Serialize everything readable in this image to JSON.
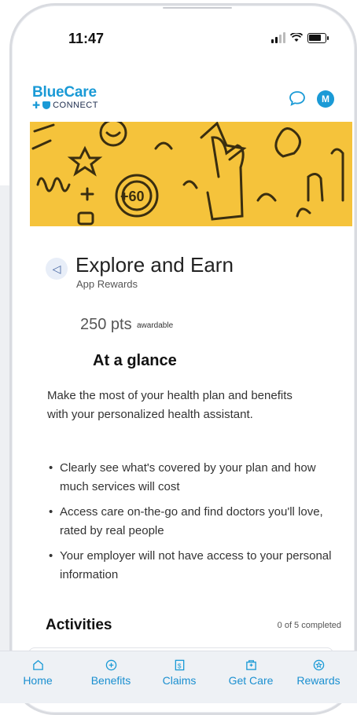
{
  "status_bar": {
    "time": "11:47"
  },
  "header": {
    "brand": "BlueCare",
    "brand_sub": "CONNECT",
    "avatar_initial": "M"
  },
  "colors": {
    "accent": "#1a9ad6",
    "hero_bg": "#f5c33b",
    "tab_bg": "#eef1f5"
  },
  "main": {
    "title": "Explore and Earn",
    "subtitle": "App Rewards",
    "points": "250 pts",
    "points_tag": "awardable",
    "section_title": "At a glance",
    "description": "Make the most of your health plan and benefits with your personalized health assistant.",
    "bullets": [
      "Clearly see what's covered by your plan and how much services will cost",
      "Access care on-the-go and find doctors you'll love, rated by real people",
      "Your employer will not have access to your personal information"
    ],
    "activities_title": "Activities",
    "activities_status": "0 of 5 completed"
  },
  "tabs": [
    {
      "label": "Home",
      "icon": "home-icon"
    },
    {
      "label": "Benefits",
      "icon": "plus-circle-icon"
    },
    {
      "label": "Claims",
      "icon": "dollar-doc-icon"
    },
    {
      "label": "Get Care",
      "icon": "hospital-icon"
    },
    {
      "label": "Rewards",
      "icon": "badge-icon"
    }
  ]
}
